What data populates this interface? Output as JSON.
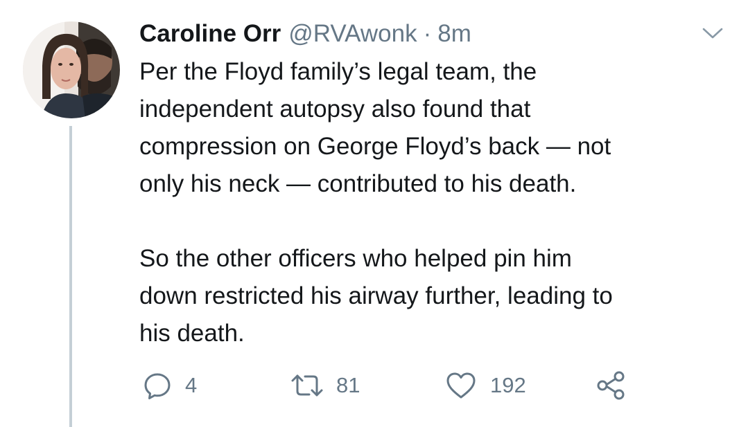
{
  "tweet": {
    "author_name": "Caroline Orr",
    "handle": "@RVAwonk",
    "separator": "·",
    "time": "8m",
    "paragraphs": [
      "Per the Floyd family’s legal team, the\nindependent autopsy also found that\ncompression on George Floyd’s back — not\nonly his neck — contributed to his death.",
      "So the other officers who helped pin him\ndown restricted his airway further, leading to\nhis death."
    ]
  },
  "actions": {
    "reply_count": "4",
    "retweet_count": "81",
    "like_count": "192"
  },
  "icons": {
    "menu": "chevron-down-icon",
    "reply": "reply-icon",
    "retweet": "retweet-icon",
    "like": "heart-icon",
    "share": "share-icon"
  },
  "colors": {
    "text_primary": "#14171a",
    "text_secondary": "#657786",
    "thread_line": "#c4cfd6"
  }
}
